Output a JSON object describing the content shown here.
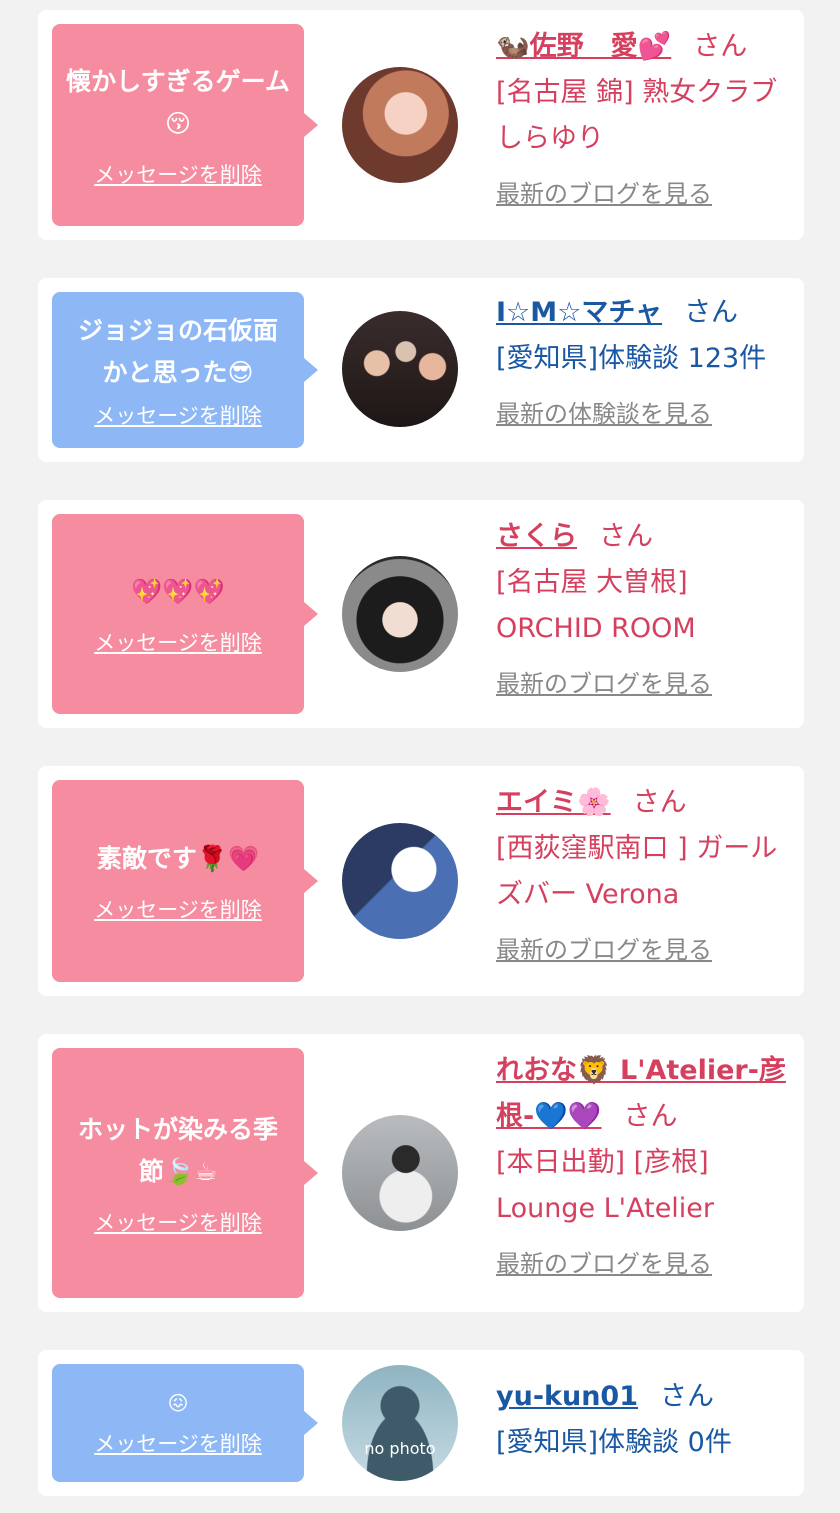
{
  "delete_label": "メッセージを削除",
  "san": "さん",
  "messages": [
    {
      "text": "懐かしすぎるゲーム",
      "emoji": "😚",
      "name_prefix_emoji": "🦦",
      "name": "佐野　愛",
      "name_suffix_emoji": "💕",
      "shop": "[名古屋 錦] 熟女クラブ しらゆり",
      "link": "最新のブログを見る"
    },
    {
      "text": "ジョジョの石仮面かと思った",
      "emoji": "😎",
      "name": "I☆M☆マチャ",
      "shop": "[愛知県]体験談 123件",
      "link": "最新の体験談を見る"
    },
    {
      "text": "",
      "emoji": "💖💖💖",
      "name": "さくら",
      "shop": "[名古屋 大曽根] ORCHID ROOM",
      "link": "最新のブログを見る"
    },
    {
      "text": "素敵です",
      "emoji": "🌹💗",
      "name": "エイミ",
      "name_suffix_emoji": "🌸",
      "shop": "[西荻窪駅南口 ] ガールズバー Verona",
      "link": "最新のブログを見る"
    },
    {
      "text": "ホットが染みる季節",
      "emoji": "🍃☕",
      "name": "れおな🦁 L'Atelier-彦根-💙💜",
      "shop": "[本日出勤] [彦根] Lounge L'Atelier",
      "link": "最新のブログを見る"
    },
    {
      "text": "",
      "emoji": "😖",
      "name": "yu-kun01",
      "shop": "[愛知県]体験談 0件",
      "avatar_text": "no photo"
    }
  ],
  "colors": {
    "pink_bubble": "#f58ca0",
    "blue_bubble": "#8eb8f5",
    "pink_text": "#d5405f",
    "blue_text": "#1a58a3",
    "background": "#f2f2f2"
  }
}
